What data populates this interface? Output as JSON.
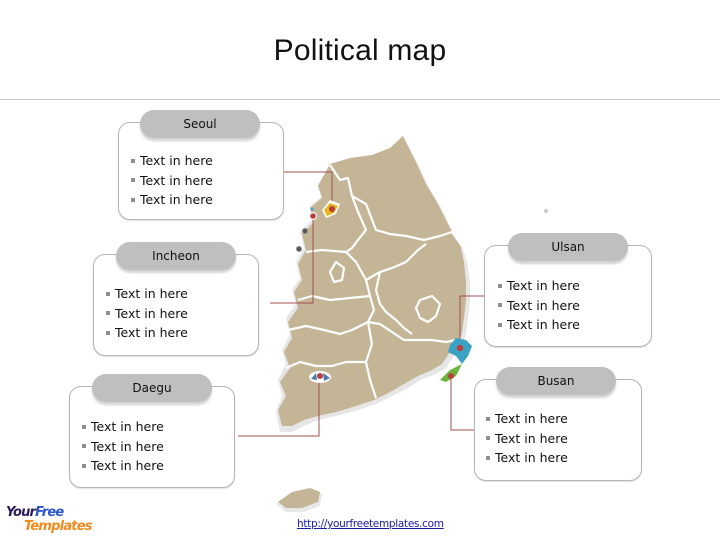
{
  "slide": {
    "title": "Political map",
    "footer_link": "http://yourfreetemplates.com",
    "logo": {
      "line1_part1": "Your",
      "line1_part2": "Free",
      "line2": "Templates"
    }
  },
  "colors": {
    "land": "#c3b596",
    "border": "#ffffff",
    "connector": "#a0504e",
    "pill": "#bfbfbf",
    "marker_red": "#b8403c",
    "seoul_icon": "#e8b51c",
    "ulsan_icon": "#3aa3c4",
    "busan_icon": "#6bb33c",
    "daegu_icon": "#4a77b0",
    "gray_dot": "#555555"
  },
  "callouts": [
    {
      "id": "seoul",
      "label": "Seoul",
      "items": [
        "Text in here",
        "Text in here",
        "Text in here"
      ]
    },
    {
      "id": "incheon",
      "label": "Incheon",
      "items": [
        "Text in here",
        "Text in here",
        "Text in here"
      ]
    },
    {
      "id": "daegu",
      "label": "Daegu",
      "items": [
        "Text in here",
        "Text in here",
        "Text in here"
      ]
    },
    {
      "id": "ulsan",
      "label": "Ulsan",
      "items": [
        "Text in here",
        "Text in here",
        "Text in here"
      ]
    },
    {
      "id": "busan",
      "label": "Busan",
      "items": [
        "Text in here",
        "Text in here",
        "Text in here"
      ]
    }
  ]
}
